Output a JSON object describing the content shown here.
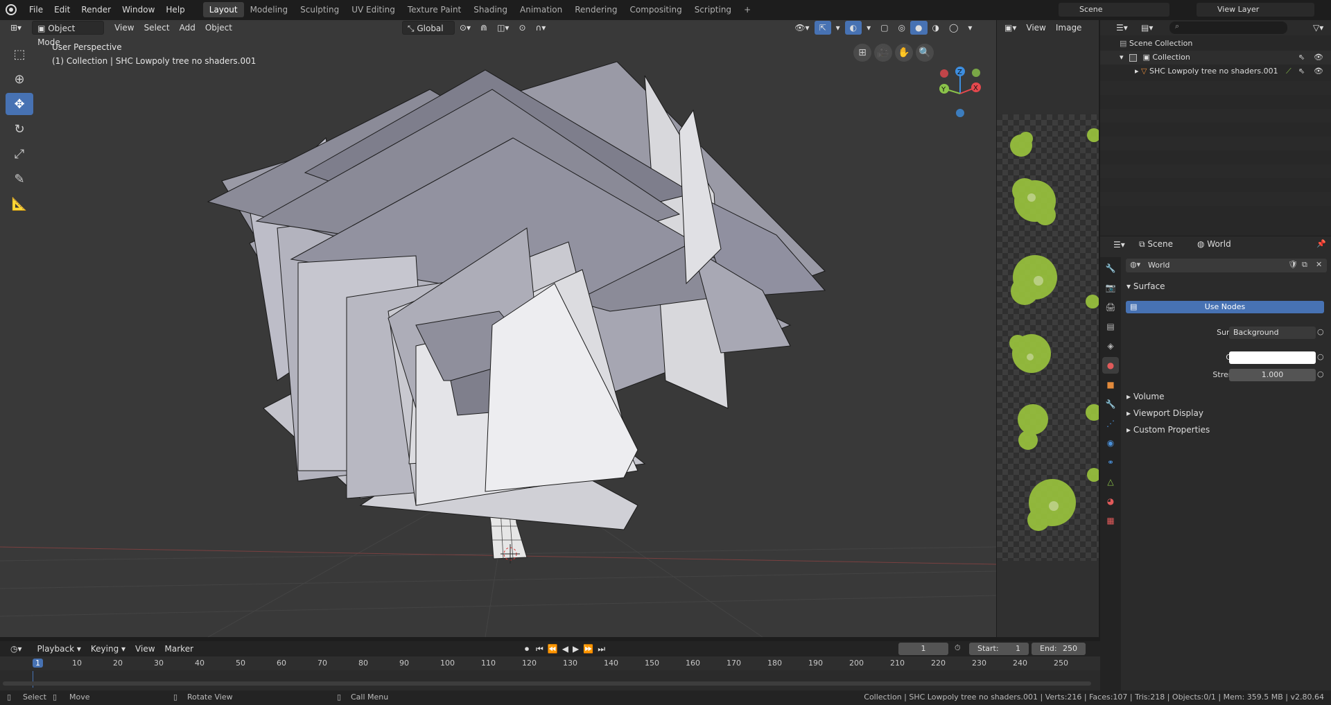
{
  "topbar": {
    "menus": [
      "File",
      "Edit",
      "Render",
      "Window",
      "Help"
    ],
    "workspaces": [
      "Layout",
      "Modeling",
      "Sculpting",
      "UV Editing",
      "Texture Paint",
      "Shading",
      "Animation",
      "Rendering",
      "Compositing",
      "Scripting"
    ],
    "active_workspace": "Layout",
    "add_tab": "+",
    "scene": "Scene",
    "view_layer": "View Layer"
  },
  "viewport": {
    "mode": "Object Mode",
    "menus": [
      "View",
      "Select",
      "Add",
      "Object"
    ],
    "transform_orientation": "Global",
    "perspective_label": "User Perspective",
    "collection_label": "(1) Collection | SHC Lowpoly tree no shaders.001",
    "gizmo": {
      "x": "X",
      "y": "Y",
      "z": "Z"
    }
  },
  "image_editor": {
    "menus": [
      "View",
      "Image"
    ]
  },
  "outliner": {
    "rows": [
      {
        "label": "Scene Collection"
      },
      {
        "label": "Collection"
      },
      {
        "label": "SHC Lowpoly tree no shaders.001"
      }
    ]
  },
  "properties": {
    "context_scene": "Scene",
    "context_world": "World",
    "world_name": "World",
    "panel_surface": "Surface",
    "use_nodes": "Use Nodes",
    "surface_label": "Surface",
    "surface_value": "Background",
    "color_label": "Color",
    "color_value": "#ffffff",
    "strength_label": "Strength",
    "strength_value": "1.000",
    "collapsed_panels": [
      "Volume",
      "Viewport Display",
      "Custom Properties"
    ]
  },
  "timeline": {
    "menus": [
      "Playback",
      "Keying",
      "View",
      "Marker"
    ],
    "current_frame": "1",
    "start_label": "Start:",
    "start_value": "1",
    "end_label": "End:",
    "end_value": "250",
    "frame_ticks": [
      "1",
      "10",
      "20",
      "30",
      "40",
      "50",
      "60",
      "70",
      "80",
      "90",
      "100",
      "110",
      "120",
      "130",
      "140",
      "150",
      "160",
      "170",
      "180",
      "190",
      "200",
      "210",
      "220",
      "230",
      "240",
      "250"
    ]
  },
  "statusbar": {
    "select": "Select",
    "move": "Move",
    "rotate": "Rotate View",
    "call_menu": "Call Menu",
    "stats": "Collection | SHC Lowpoly tree no shaders.001 | Verts:216 | Faces:107 | Tris:218 | Objects:0/1 | Mem: 359.5 MB | v2.80.64"
  },
  "colors": {
    "accent": "#4772b3",
    "axis_x": "#e5484d",
    "axis_y": "#8bc34a",
    "axis_z": "#3d8ee0",
    "foliage": "#9bc53d"
  }
}
